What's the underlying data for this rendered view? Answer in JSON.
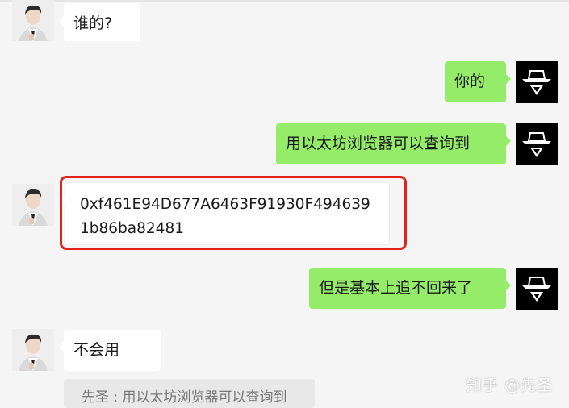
{
  "messages": [
    {
      "id": "m1",
      "side": "in",
      "text": "谁的?"
    },
    {
      "id": "m2",
      "side": "out",
      "text": "你的"
    },
    {
      "id": "m3",
      "side": "out",
      "text": "用以太坊浏览器可以查询到"
    },
    {
      "id": "m4",
      "side": "in",
      "text": "0xf461E94D677A6463F91930F4946391b86ba82481"
    },
    {
      "id": "m5",
      "side": "out",
      "text": "但是基本上追不回来了"
    },
    {
      "id": "m6",
      "side": "in",
      "text": "不会用"
    }
  ],
  "quote": {
    "text": "先圣 : 用以太坊浏览器可以查询到"
  },
  "watermark": {
    "text": "知乎 @先圣"
  },
  "colors": {
    "incoming_bubble": "#ffffff",
    "outgoing_bubble": "#95ec69",
    "highlight": "#e2231a",
    "background": "#f5f5f5"
  },
  "avatars": {
    "contact": "man-portrait-avatar",
    "self": "hooded-figure-avatar"
  }
}
